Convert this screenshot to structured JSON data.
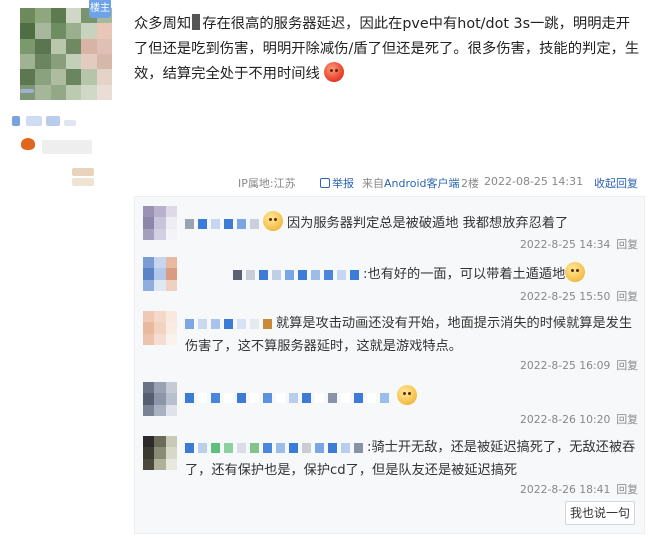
{
  "user": {
    "badge": "楼主",
    "avatar_colors": [
      "#6c8a5a",
      "#8fa77e",
      "#5d7a50",
      "#cfd8c6",
      "#7b9470",
      "#a6b99b",
      "#4f6e44",
      "#a8b89c",
      "#6e8d63",
      "#9bae8f",
      "#c7d3bd",
      "#e8c6b8",
      "#7a9a6e",
      "#5a7550",
      "#b9c7ad",
      "#6f8a62",
      "#d9b3a5",
      "#e0c0b4",
      "#9fb394",
      "#6b8560",
      "#889e7c",
      "#c4cfb9",
      "#e2cbbf",
      "#d6b8ab",
      "#5c7752",
      "#8aa27d",
      "#aebd9f",
      "#6a8660",
      "#b6c4a9",
      "#e5d2c8",
      "#7f9874",
      "#a5b69a",
      "#92a886",
      "#bccab0",
      "#d0d9c6",
      "#e9ddd6"
    ],
    "medal_icon": "flame-medal-icon"
  },
  "post": {
    "text_a": "众多周知",
    "text_b": "存在很高的服务器延迟，因此在pve中有hot/dot 3s一跳，明明走开了但还是吃到伤害，明明开除减伤/盾了但还是死了。很多伤害，技能的判定，生效，结算完全处于不用时间线",
    "emoji": "angry-face-icon"
  },
  "meta": {
    "ip": "IP属地:江苏",
    "report": "举报",
    "source_prefix": "来自",
    "source_link": "Android客户端",
    "floor": "2楼",
    "time": "2022-08-25 14:31",
    "collapse": "收起回复"
  },
  "replies": [
    {
      "text": "因为服务器判定总是被破遁地 我都想放弃忍着了",
      "emoji_before": true,
      "time": "2022-8-25 14:34",
      "reply_label": "回复",
      "avatar": [
        "#9a93b3",
        "#b7b1cc",
        "#ddd9e8",
        "#8c86a8",
        "#c9c4db",
        "#efedf4",
        "#a59fbe",
        "#d3cfe2",
        "#f4f3f8"
      ],
      "nick": [
        "#9aa3b5",
        "#3c7bd6",
        "#c5d6ef",
        "#3c7bd6",
        "#7aa7e3",
        "#c9d1de"
      ]
    },
    {
      "text": ":也有好的一面，可以带着土遁遁地",
      "emoji_after": true,
      "time": "2022-8-25 15:50",
      "reply_label": "回复",
      "avatar": [
        "#7b9cd3",
        "#c7d6ef",
        "#e8b8a0",
        "#5b84c6",
        "#b3c8ea",
        "#d99c82",
        "#8fadde",
        "#dde7f5",
        "#f0d0c0"
      ],
      "nick": [
        "#5b6170",
        "#c8ccd4",
        "#3c7bd6",
        "#bfcfe8",
        "#7aa7e3",
        "#3c7bd6",
        "#9bbde9",
        "#4a86d9",
        "#c6d8f1",
        "#3c7bd6"
      ]
    },
    {
      "text": "就算是攻击动画还没有开始，地面提示消失的时候就算是发生伤害了，这不算服务器延时，这就是游戏特点。",
      "time": "2022-8-25 16:09",
      "reply_label": "回复",
      "avatar": [
        "#f0c9b4",
        "#f4d9ca",
        "#f8e8de",
        "#e8b99f",
        "#f2d2c1",
        "#f9ece5",
        "#ecc4ae",
        "#f5ddd0",
        "#fbf2ec"
      ],
      "nick": [
        "#7ea6e0",
        "#c9d9f0",
        "#a9c4ec",
        "#3c7bd6",
        "#d7e3f4",
        "#e6e9ee",
        "#c9883a"
      ]
    },
    {
      "text": "",
      "emoji_after": true,
      "time": "2022-8-26 10:20",
      "reply_label": "回复",
      "avatar": [
        "#6b7386",
        "#9aa1b2",
        "#c5cad6",
        "#575f72",
        "#8d95a8",
        "#b8bfcd",
        "#7a8396",
        "#a9b0c0",
        "#dfe2ea"
      ],
      "nick": [
        "#3c7bd6",
        "#ffffff",
        "#4a86d9",
        "#ffffff",
        "#3c7bd6",
        "#ffffff",
        "#5b92dd",
        "#ffffff",
        "#b9cdee",
        "#3c7bd6",
        "#ffffff",
        "#8a93a5",
        "#ffffff",
        "#3c7bd6",
        "#ffffff",
        "#9bbde9"
      ]
    },
    {
      "text": ":骑士开无敌，还是被延迟搞死了，无敌还被吞了，还有保护也是，保护cd了，但是队友还是被延迟搞死",
      "time": "2022-8-26 18:41",
      "reply_label": "回复",
      "avatar": [
        "#2a2a2a",
        "#6b6b5a",
        "#c9c9b8",
        "#3a3a30",
        "#8a8a75",
        "#d8d8c8",
        "#4a4a3c",
        "#b0b09a",
        "#e8e8dc"
      ],
      "nick": [
        "#3c7bd6",
        "#bcd0ee",
        "#5ec07a",
        "#8fd0a0",
        "#d9dde5",
        "#7fc48f",
        "#4a86d9",
        "#9bbde9",
        "#3c7bd6",
        "#c8ccd4",
        "#7aa7e3",
        "#3c7bd6",
        "#b9cdee",
        "#8a93a5"
      ]
    }
  ],
  "post_reply_button": "我也说一句"
}
